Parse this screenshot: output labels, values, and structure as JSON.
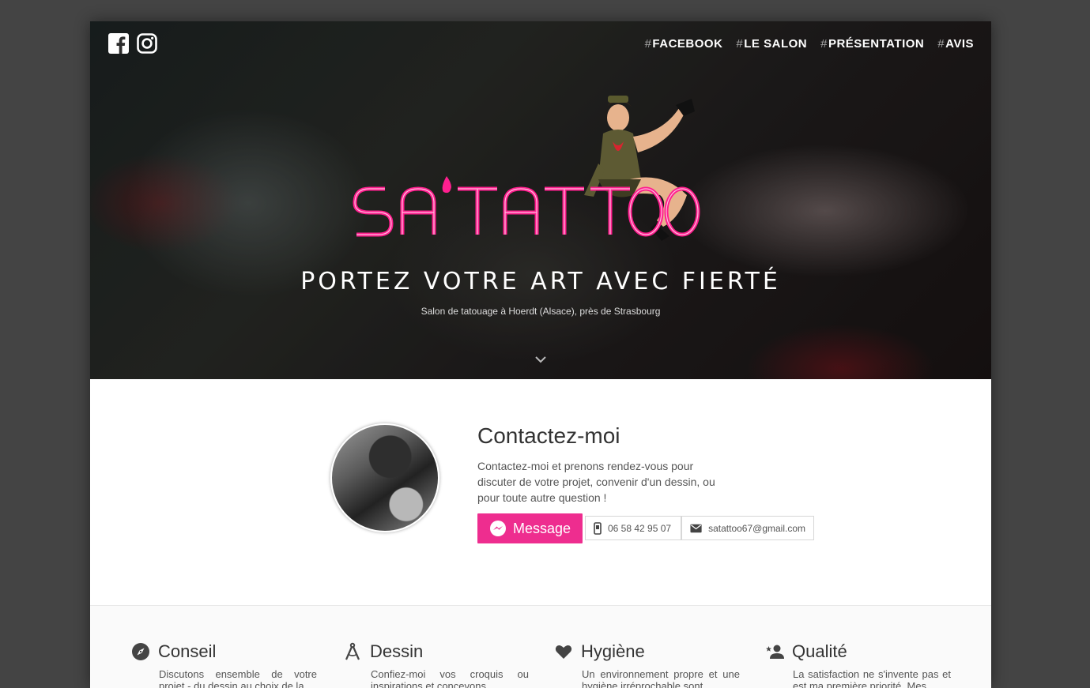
{
  "hero": {
    "logo_text": "SA' TATTOO",
    "tagline": "PORTEZ VOTRE ART AVEC FIERTÉ",
    "subtitle": "Salon de tatouage à Hoerdt (Alsace), près de Strasbourg",
    "nav": [
      {
        "hash": "#",
        "label": "FACEBOOK"
      },
      {
        "hash": "#",
        "label": "LE SALON"
      },
      {
        "hash": "#",
        "label": "PRÉSENTATION"
      },
      {
        "hash": "#",
        "label": "AVIS"
      }
    ],
    "social_icons": [
      "facebook-icon",
      "instagram-icon"
    ]
  },
  "contact": {
    "title": "Contactez-moi",
    "text": "Contactez-moi et prenons rendez-vous pour discuter de votre projet, convenir d'un dessin, ou pour toute autre question !",
    "message_label": "Message",
    "phone": "06 58 42 95 07",
    "email": "satattoo67@gmail.com"
  },
  "features": [
    {
      "icon": "compass-icon",
      "title": "Conseil",
      "text": "Discutons ensemble de votre projet - du dessin au choix de la"
    },
    {
      "icon": "drafting-compass-icon",
      "title": "Dessin",
      "text": "Confiez-moi vos croquis ou inspirations et concevons"
    },
    {
      "icon": "heart-icon",
      "title": "Hygiène",
      "text": "Un environnement propre et une hygiène irréprochable sont"
    },
    {
      "icon": "user-star-icon",
      "title": "Qualité",
      "text": "La satisfaction ne s'invente pas et est ma première priorité. Mes"
    }
  ],
  "colors": {
    "accent": "#ee2d8f",
    "outer_background": "#444444",
    "text_dark": "#333333"
  }
}
